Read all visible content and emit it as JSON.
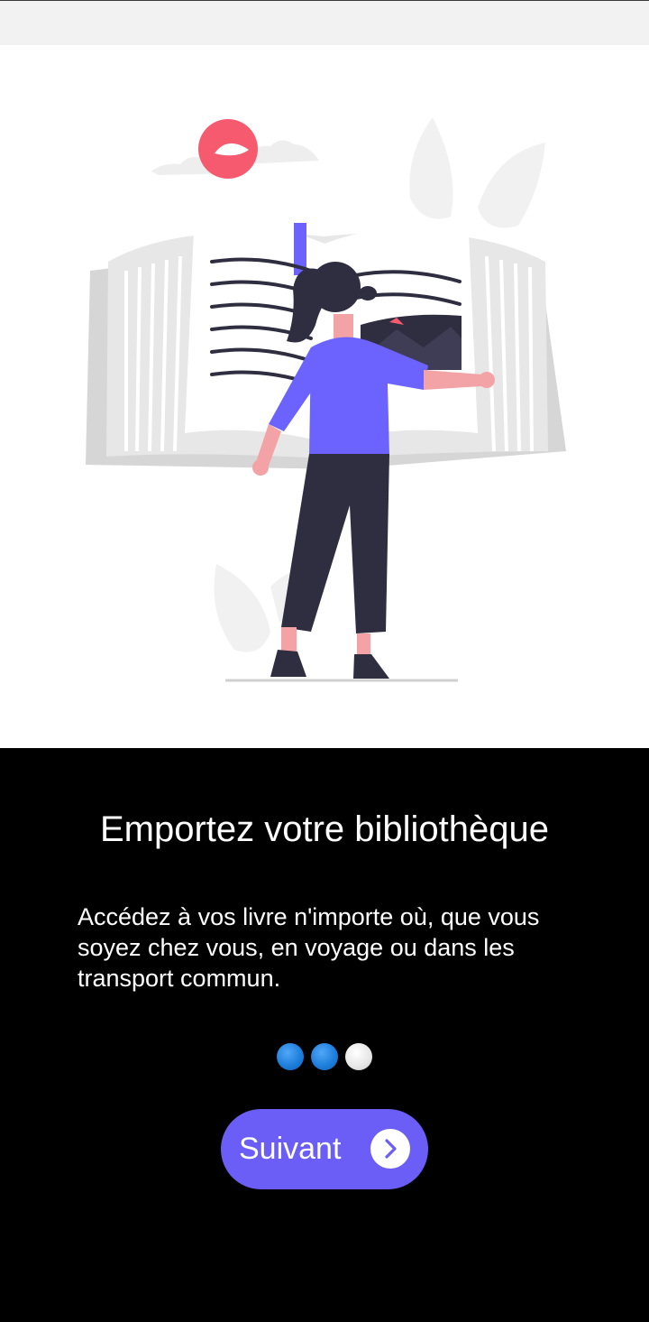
{
  "onboarding": {
    "title": "Emportez votre bibliothèque",
    "description": "Accédez à vos livre n'importe où, que vous soyez chez vous, en voyage ou dans les transport commun.",
    "pager": {
      "total": 3,
      "active_color": "#1e7fdc",
      "inactive_color": "#e6e6e6"
    },
    "next_button": {
      "label": "Suivant",
      "icon": "chevron-right-icon",
      "color": "#6b5ef6"
    }
  },
  "illustration": {
    "subject": "woman-reading-giant-book",
    "accent_color": "#6c63ff",
    "sun_color": "#f55a6e"
  }
}
